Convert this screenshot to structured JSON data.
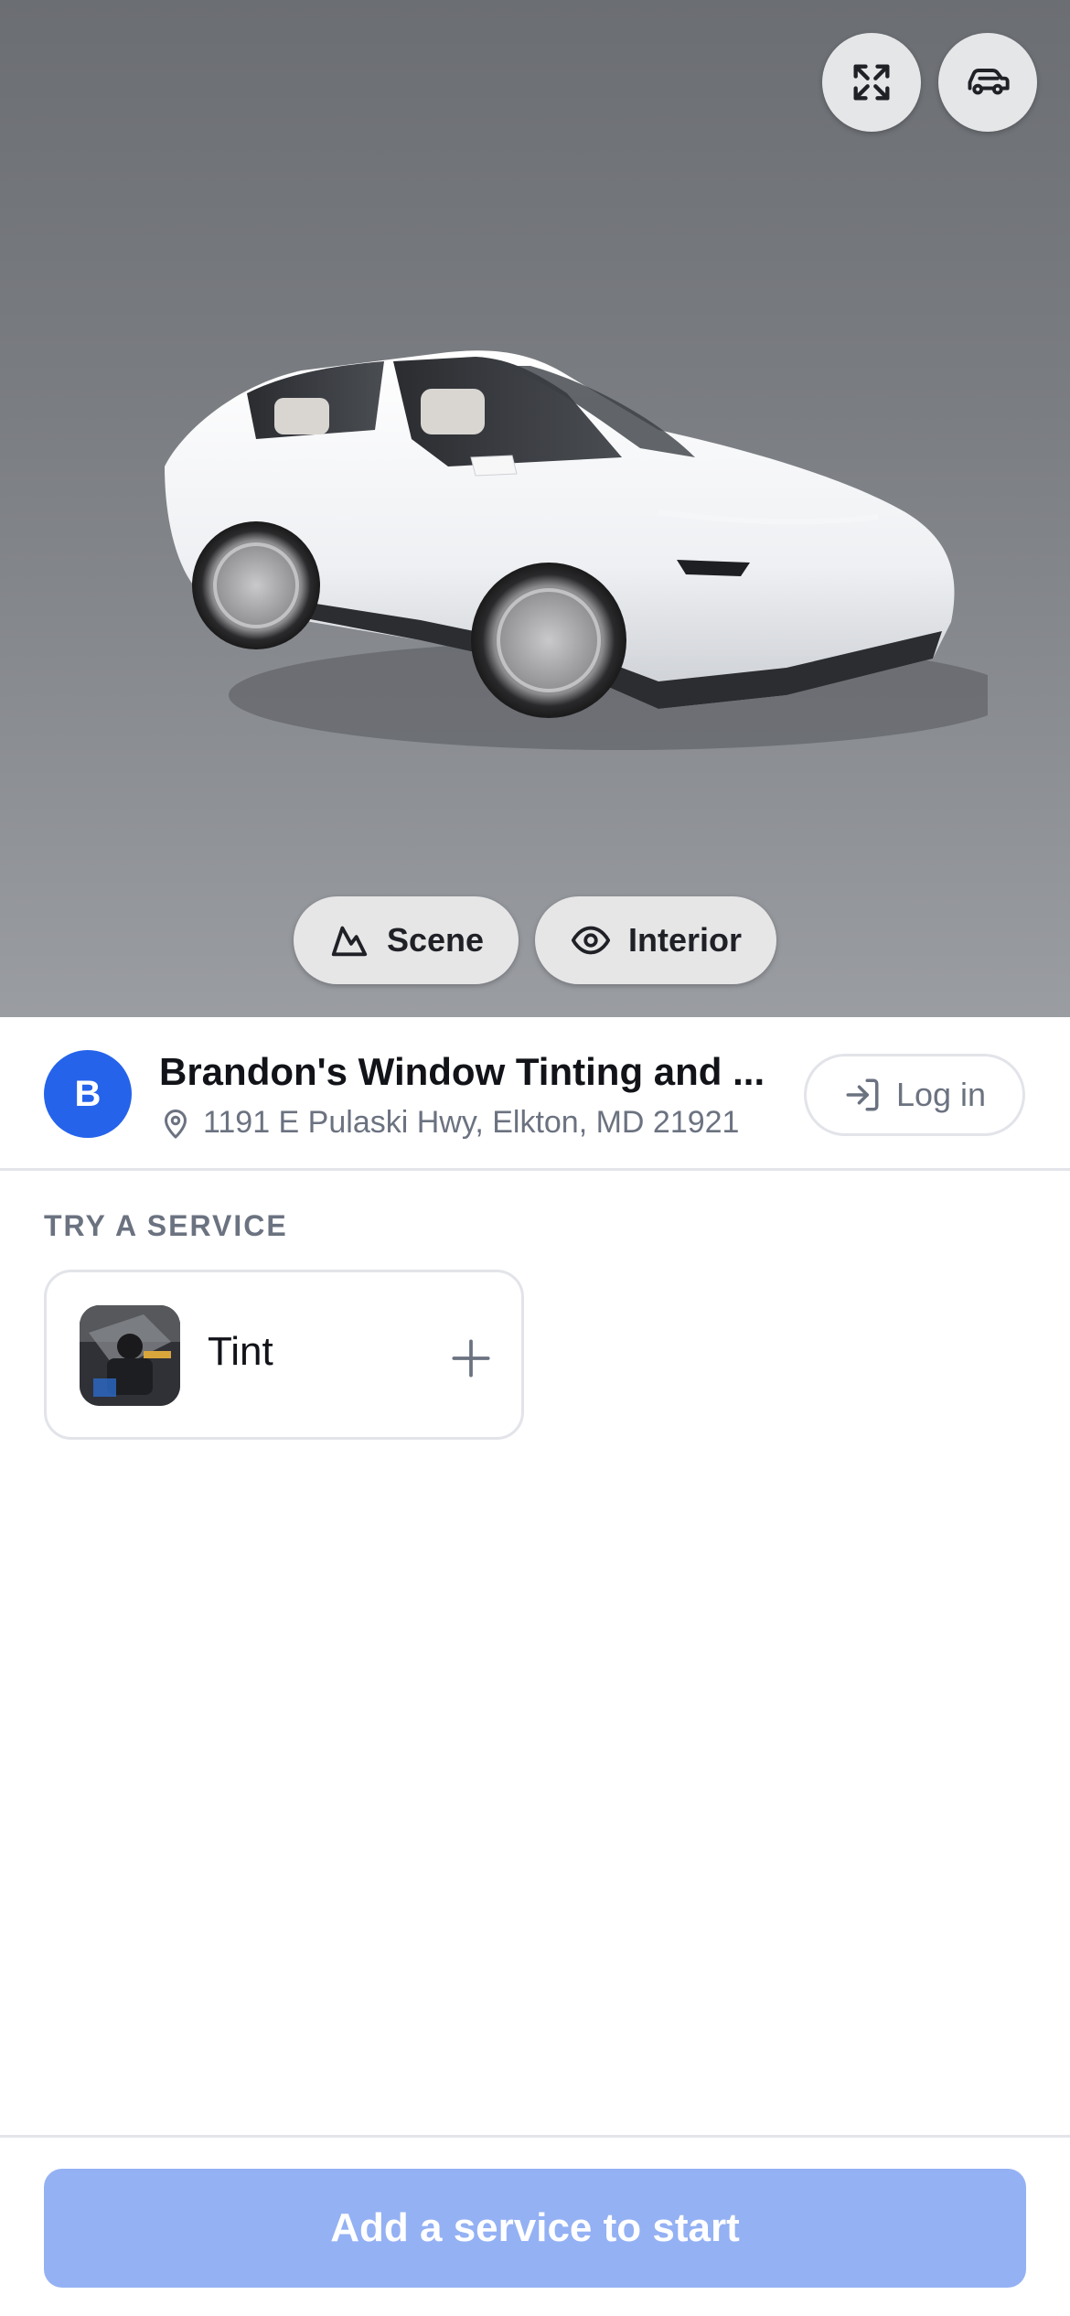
{
  "viewer": {
    "expand_icon": "expand-icon",
    "car_icon": "car-icon",
    "scene_label": "Scene",
    "interior_label": "Interior"
  },
  "shop": {
    "avatar_letter": "B",
    "name": "Brandon's Window Tinting and ...",
    "address": "1191 E Pulaski Hwy, Elkton, MD 21921",
    "login_label": "Log in"
  },
  "services": {
    "section_title": "TRY A SERVICE",
    "items": [
      {
        "name": "Tint"
      }
    ]
  },
  "footer": {
    "cta_label": "Add a service to start"
  },
  "colors": {
    "accent": "#2563eb",
    "cta_disabled": "#94b1f4",
    "muted_text": "#6b7280"
  }
}
